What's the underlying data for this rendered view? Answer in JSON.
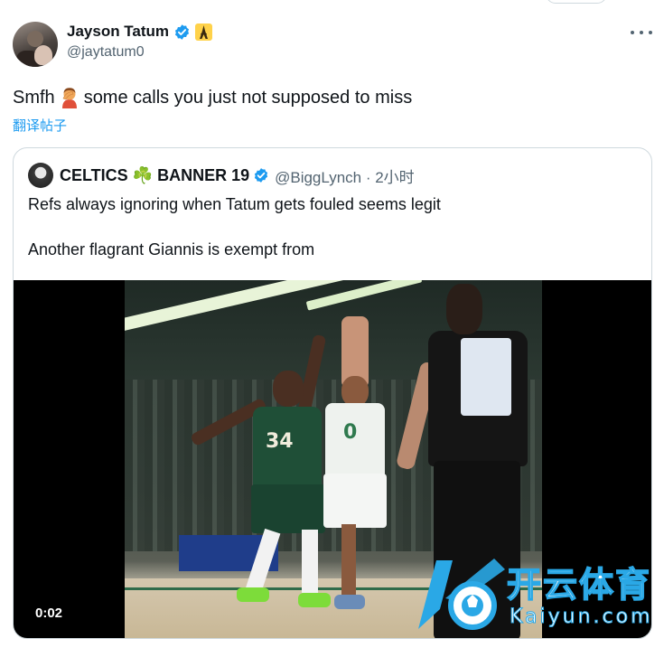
{
  "author": {
    "display_name": "Jayson Tatum",
    "handle": "@jaytatum0"
  },
  "tweet": {
    "text_before_emoji": "Smfh",
    "text_after_emoji": "some calls you just not supposed to miss",
    "translate_label": "翻译帖子"
  },
  "quoted": {
    "name": "CELTICS ☘️ BANNER 19",
    "handle_time": "@BiggLynch · 2小时",
    "text_line1": "Refs always ignoring when Tatum gets fouled seems legit",
    "text_line2": "Another flagrant Giannis is exempt from"
  },
  "video": {
    "timestamp": "0:02",
    "bucks_number": "34",
    "celtics_number": "0"
  },
  "watermark": {
    "cn": "开云体育",
    "en": "Kaiyun.com"
  },
  "colors": {
    "verified_blue": "#1d9bf0",
    "link_blue": "#1d9bf0",
    "secondary_text": "#536471",
    "watermark_blue": "#2aa8e6"
  },
  "icons": {
    "verified": "verified-badge-icon",
    "tower": "tower-badge-icon",
    "more": "more-options-icon",
    "emoji": "person-facepalming-emoji"
  }
}
